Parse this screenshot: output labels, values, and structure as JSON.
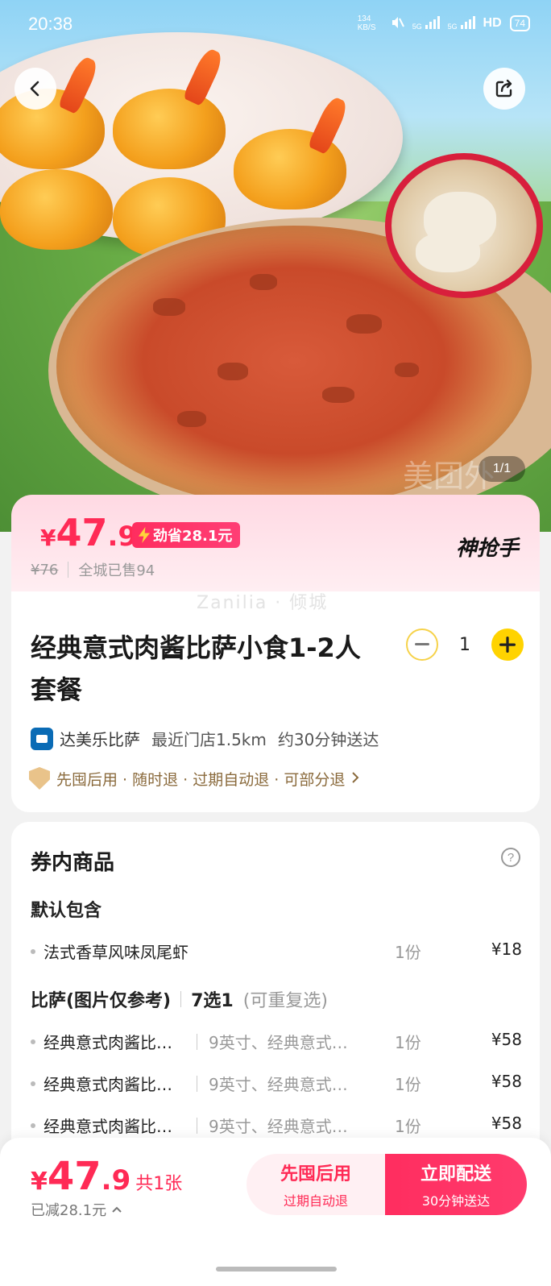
{
  "status_bar": {
    "time": "20:38",
    "net_speed": "134 KB/S",
    "signal_1": "5G",
    "signal_2": "5G",
    "hd": "HD",
    "battery": "74"
  },
  "hero": {
    "pager": "1/1",
    "watermark": "美团外"
  },
  "price_banner": {
    "currency": "¥",
    "price_int": "47",
    "price_dec": ".9",
    "save_badge": "劲省28.1元",
    "original_price": "¥76",
    "sold_text": "全城已售94",
    "brand_tag": "神抢手"
  },
  "product": {
    "watermark": "Zanilia · 倾城",
    "title": "经典意式肉酱比萨小食1-2人套餐",
    "quantity": "1",
    "shop_name": "达美乐比萨",
    "distance": "最近门店1.5km",
    "delivery_time": "约30分钟送达",
    "guarantee": "先囤后用 · 随时退 · 过期自动退 · 可部分退"
  },
  "contents": {
    "title": "券内商品",
    "default_section": "默认包含",
    "default_items": [
      {
        "name": "法式香草风味凤尾虾",
        "qty": "1份",
        "price": "¥18"
      }
    ],
    "pizza_section": {
      "label": "比萨(图片仅参考)",
      "count": "7选1",
      "note": "(可重复选)"
    },
    "pizza_items": [
      {
        "name": "经典意式肉酱比…",
        "desc": "9英寸、经典意式…",
        "qty": "1份",
        "price": "¥58"
      },
      {
        "name": "经典意式肉酱比…",
        "desc": "9英寸、经典意式…",
        "qty": "1份",
        "price": "¥58"
      },
      {
        "name": "经典意式肉酱比…",
        "desc": "9英寸、经典意式…",
        "qty": "1份",
        "price": "¥58"
      }
    ]
  },
  "bottom_bar": {
    "currency": "¥",
    "price_int": "47",
    "price_dec": ".9",
    "count": "共1张",
    "saved": "已减28.1元",
    "btn_later": {
      "label": "先囤后用",
      "sub": "过期自动退"
    },
    "btn_now": {
      "label": "立即配送",
      "sub": "30分钟送达"
    }
  },
  "colors": {
    "accent": "#ff2a55",
    "stepper_yellow": "#ffd300"
  }
}
